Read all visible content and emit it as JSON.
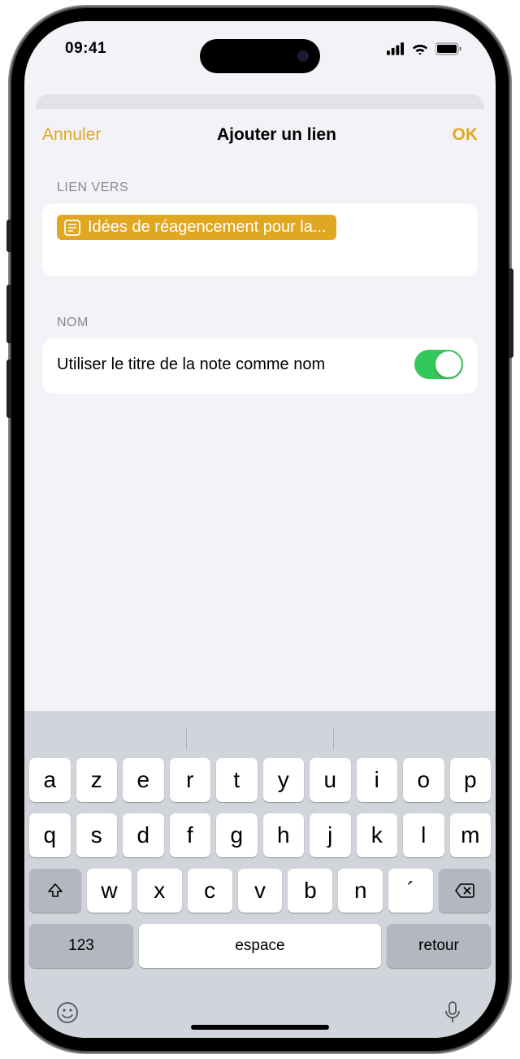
{
  "status": {
    "time": "09:41"
  },
  "modal": {
    "cancel": "Annuler",
    "title": "Ajouter un lien",
    "ok": "OK"
  },
  "link_section": {
    "label": "LIEN VERS",
    "chip_text": "Idées de réagencement pour la..."
  },
  "name_section": {
    "label": "NOM",
    "toggle_label": "Utiliser le titre de la note comme nom",
    "toggle_on": true
  },
  "keyboard": {
    "row1": [
      "a",
      "z",
      "e",
      "r",
      "t",
      "y",
      "u",
      "i",
      "o",
      "p"
    ],
    "row2": [
      "q",
      "s",
      "d",
      "f",
      "g",
      "h",
      "j",
      "k",
      "l",
      "m"
    ],
    "row3": [
      "w",
      "x",
      "c",
      "v",
      "b",
      "n",
      "´"
    ],
    "num_key": "123",
    "space": "espace",
    "return": "retour"
  }
}
